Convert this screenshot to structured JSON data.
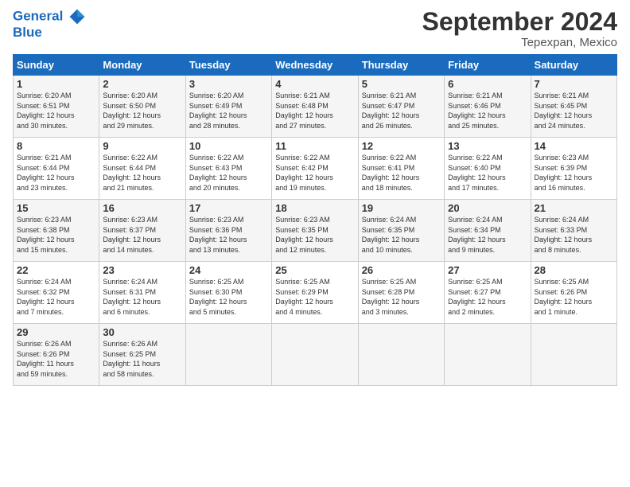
{
  "header": {
    "logo_line1": "General",
    "logo_line2": "Blue",
    "month": "September 2024",
    "location": "Tepexpan, Mexico"
  },
  "weekdays": [
    "Sunday",
    "Monday",
    "Tuesday",
    "Wednesday",
    "Thursday",
    "Friday",
    "Saturday"
  ],
  "weeks": [
    [
      {
        "day": "1",
        "info": "Sunrise: 6:20 AM\nSunset: 6:51 PM\nDaylight: 12 hours\nand 30 minutes."
      },
      {
        "day": "2",
        "info": "Sunrise: 6:20 AM\nSunset: 6:50 PM\nDaylight: 12 hours\nand 29 minutes."
      },
      {
        "day": "3",
        "info": "Sunrise: 6:20 AM\nSunset: 6:49 PM\nDaylight: 12 hours\nand 28 minutes."
      },
      {
        "day": "4",
        "info": "Sunrise: 6:21 AM\nSunset: 6:48 PM\nDaylight: 12 hours\nand 27 minutes."
      },
      {
        "day": "5",
        "info": "Sunrise: 6:21 AM\nSunset: 6:47 PM\nDaylight: 12 hours\nand 26 minutes."
      },
      {
        "day": "6",
        "info": "Sunrise: 6:21 AM\nSunset: 6:46 PM\nDaylight: 12 hours\nand 25 minutes."
      },
      {
        "day": "7",
        "info": "Sunrise: 6:21 AM\nSunset: 6:45 PM\nDaylight: 12 hours\nand 24 minutes."
      }
    ],
    [
      {
        "day": "8",
        "info": "Sunrise: 6:21 AM\nSunset: 6:44 PM\nDaylight: 12 hours\nand 23 minutes."
      },
      {
        "day": "9",
        "info": "Sunrise: 6:22 AM\nSunset: 6:44 PM\nDaylight: 12 hours\nand 21 minutes."
      },
      {
        "day": "10",
        "info": "Sunrise: 6:22 AM\nSunset: 6:43 PM\nDaylight: 12 hours\nand 20 minutes."
      },
      {
        "day": "11",
        "info": "Sunrise: 6:22 AM\nSunset: 6:42 PM\nDaylight: 12 hours\nand 19 minutes."
      },
      {
        "day": "12",
        "info": "Sunrise: 6:22 AM\nSunset: 6:41 PM\nDaylight: 12 hours\nand 18 minutes."
      },
      {
        "day": "13",
        "info": "Sunrise: 6:22 AM\nSunset: 6:40 PM\nDaylight: 12 hours\nand 17 minutes."
      },
      {
        "day": "14",
        "info": "Sunrise: 6:23 AM\nSunset: 6:39 PM\nDaylight: 12 hours\nand 16 minutes."
      }
    ],
    [
      {
        "day": "15",
        "info": "Sunrise: 6:23 AM\nSunset: 6:38 PM\nDaylight: 12 hours\nand 15 minutes."
      },
      {
        "day": "16",
        "info": "Sunrise: 6:23 AM\nSunset: 6:37 PM\nDaylight: 12 hours\nand 14 minutes."
      },
      {
        "day": "17",
        "info": "Sunrise: 6:23 AM\nSunset: 6:36 PM\nDaylight: 12 hours\nand 13 minutes."
      },
      {
        "day": "18",
        "info": "Sunrise: 6:23 AM\nSunset: 6:35 PM\nDaylight: 12 hours\nand 12 minutes."
      },
      {
        "day": "19",
        "info": "Sunrise: 6:24 AM\nSunset: 6:35 PM\nDaylight: 12 hours\nand 10 minutes."
      },
      {
        "day": "20",
        "info": "Sunrise: 6:24 AM\nSunset: 6:34 PM\nDaylight: 12 hours\nand 9 minutes."
      },
      {
        "day": "21",
        "info": "Sunrise: 6:24 AM\nSunset: 6:33 PM\nDaylight: 12 hours\nand 8 minutes."
      }
    ],
    [
      {
        "day": "22",
        "info": "Sunrise: 6:24 AM\nSunset: 6:32 PM\nDaylight: 12 hours\nand 7 minutes."
      },
      {
        "day": "23",
        "info": "Sunrise: 6:24 AM\nSunset: 6:31 PM\nDaylight: 12 hours\nand 6 minutes."
      },
      {
        "day": "24",
        "info": "Sunrise: 6:25 AM\nSunset: 6:30 PM\nDaylight: 12 hours\nand 5 minutes."
      },
      {
        "day": "25",
        "info": "Sunrise: 6:25 AM\nSunset: 6:29 PM\nDaylight: 12 hours\nand 4 minutes."
      },
      {
        "day": "26",
        "info": "Sunrise: 6:25 AM\nSunset: 6:28 PM\nDaylight: 12 hours\nand 3 minutes."
      },
      {
        "day": "27",
        "info": "Sunrise: 6:25 AM\nSunset: 6:27 PM\nDaylight: 12 hours\nand 2 minutes."
      },
      {
        "day": "28",
        "info": "Sunrise: 6:25 AM\nSunset: 6:26 PM\nDaylight: 12 hours\nand 1 minute."
      }
    ],
    [
      {
        "day": "29",
        "info": "Sunrise: 6:26 AM\nSunset: 6:26 PM\nDaylight: 11 hours\nand 59 minutes."
      },
      {
        "day": "30",
        "info": "Sunrise: 6:26 AM\nSunset: 6:25 PM\nDaylight: 11 hours\nand 58 minutes."
      },
      {
        "day": "",
        "info": ""
      },
      {
        "day": "",
        "info": ""
      },
      {
        "day": "",
        "info": ""
      },
      {
        "day": "",
        "info": ""
      },
      {
        "day": "",
        "info": ""
      }
    ]
  ]
}
